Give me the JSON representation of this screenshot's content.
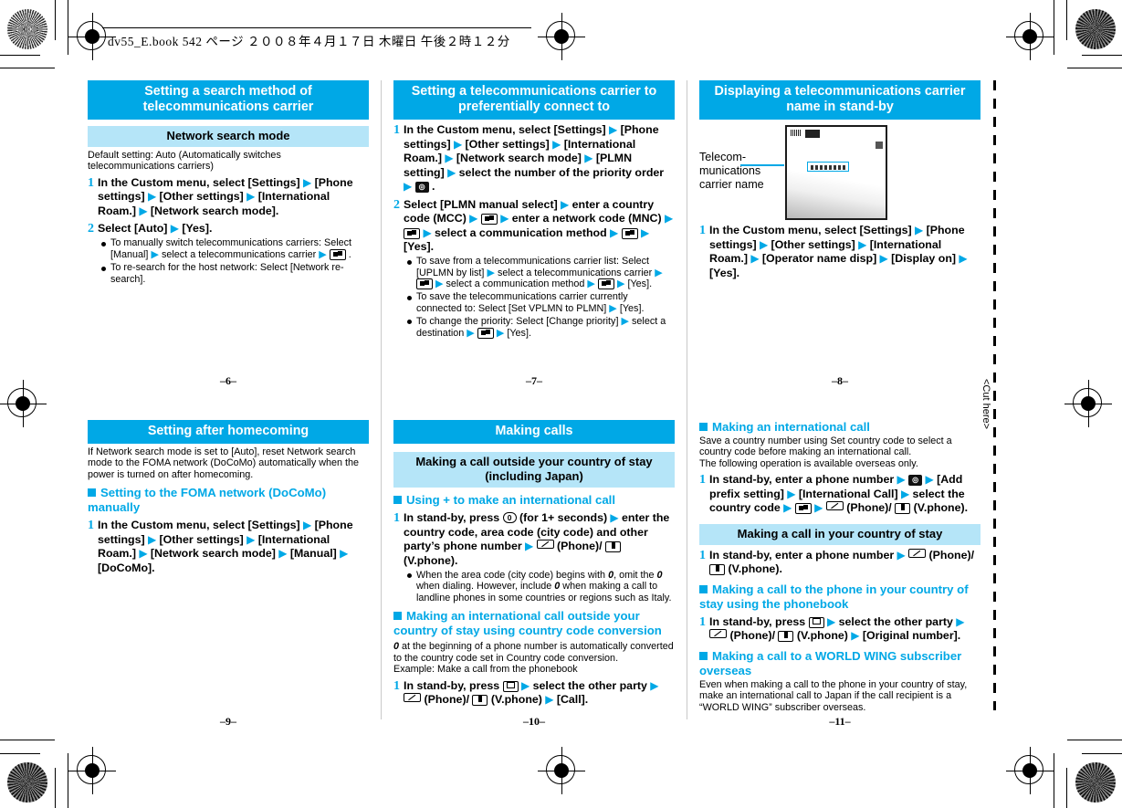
{
  "print": {
    "slug": "dv55_E.book  542 ページ  ２００８年４月１７日  木曜日  午後２時１２分",
    "cut_here": "<Cut here>"
  },
  "pages": [
    {
      "folio": "–6–",
      "title": "Setting a search method of telecommunications carrier",
      "subtitle": "Network search mode",
      "intro": "Default setting: Auto (Automatically switches telecommunications carriers)",
      "steps": [
        {
          "num": "1",
          "parts": [
            {
              "t": "In the Custom menu, select [Settings]"
            },
            {
              "a": "▶"
            },
            {
              "t": "[Phone settings]"
            },
            {
              "a": "▶"
            },
            {
              "t": "[Other settings]"
            },
            {
              "a": "▶"
            },
            {
              "t": "[International Roam.]"
            },
            {
              "a": "▶"
            },
            {
              "t": "[Network search mode]."
            }
          ]
        },
        {
          "num": "2",
          "parts": [
            {
              "t": "Select [Auto]"
            },
            {
              "a": "▶"
            },
            {
              "t": "[Yes]."
            }
          ],
          "bullets": [
            [
              {
                "t": "To manually switch telecommunications carriers: Select [Manual]"
              },
              {
                "a": "▶"
              },
              {
                "t": "select a telecommunications carrier"
              },
              {
                "a": "▶"
              },
              {
                "k": "sel"
              },
              {
                "t": "."
              }
            ],
            [
              {
                "t": "To re-search for the host network: Select [Network re-search]."
              }
            ]
          ]
        }
      ]
    },
    {
      "folio": "–7–",
      "title": "Setting a telecommunications carrier to preferentially connect to",
      "steps": [
        {
          "num": "1",
          "parts": [
            {
              "t": "In the Custom menu, select [Settings]"
            },
            {
              "a": "▶"
            },
            {
              "t": "[Phone settings]"
            },
            {
              "a": "▶"
            },
            {
              "t": "[Other settings]"
            },
            {
              "a": "▶"
            },
            {
              "t": "[International Roam.]"
            },
            {
              "a": "▶"
            },
            {
              "t": "[Network search mode]"
            },
            {
              "a": "▶"
            },
            {
              "t": "[PLMN setting]"
            },
            {
              "a": "▶"
            },
            {
              "t": "select the number of the priority order"
            },
            {
              "a": "▶"
            },
            {
              "k": "cam"
            },
            {
              "t": "."
            }
          ]
        },
        {
          "num": "2",
          "parts": [
            {
              "t": "Select [PLMN manual select]"
            },
            {
              "a": "▶"
            },
            {
              "t": "enter a country code (MCC)"
            },
            {
              "a": "▶"
            },
            {
              "k": "sel"
            },
            {
              "a": "▶"
            },
            {
              "t": "enter a network code (MNC)"
            },
            {
              "a": "▶"
            },
            {
              "k": "sel"
            },
            {
              "a": "▶"
            },
            {
              "t": "select a communication method"
            },
            {
              "a": "▶"
            },
            {
              "k": "sel"
            },
            {
              "a": "▶"
            },
            {
              "t": "[Yes]."
            }
          ],
          "bullets": [
            [
              {
                "t": "To save from a telecommunications carrier list: Select [UPLMN by list]"
              },
              {
                "a": "▶"
              },
              {
                "t": "select a telecommunications carrier"
              },
              {
                "a": "▶"
              },
              {
                "k": "sel"
              },
              {
                "a": "▶"
              },
              {
                "t": "select a communication method"
              },
              {
                "a": "▶"
              },
              {
                "k": "sel"
              },
              {
                "a": "▶"
              },
              {
                "t": "[Yes]."
              }
            ],
            [
              {
                "t": "To save the telecommunications carrier currently connected to: Select [Set VPLMN to PLMN]"
              },
              {
                "a": "▶"
              },
              {
                "t": "[Yes]."
              }
            ],
            [
              {
                "t": "To change the priority: Select [Change priority]"
              },
              {
                "a": "▶"
              },
              {
                "t": "select a destination"
              },
              {
                "a": "▶"
              },
              {
                "k": "sel"
              },
              {
                "a": "▶"
              },
              {
                "t": "[Yes]."
              }
            ]
          ]
        }
      ]
    },
    {
      "folio": "–8–",
      "title": "Displaying a telecommunications carrier name in stand-by",
      "illustration_label": "Telecom-\nmunications\ncarrier name",
      "steps": [
        {
          "num": "1",
          "parts": [
            {
              "t": "In the Custom menu, select [Settings]"
            },
            {
              "a": "▶"
            },
            {
              "t": "[Phone settings]"
            },
            {
              "a": "▶"
            },
            {
              "t": "[Other settings]"
            },
            {
              "a": "▶"
            },
            {
              "t": "[International Roam.]"
            },
            {
              "a": "▶"
            },
            {
              "t": "[Operator name disp]"
            },
            {
              "a": "▶"
            },
            {
              "t": "[Display on]"
            },
            {
              "a": "▶"
            },
            {
              "t": "[Yes]."
            }
          ]
        }
      ]
    },
    {
      "folio": "–9–",
      "title": "Setting after homecoming",
      "intro": "If Network search mode is set to [Auto], reset Network search mode to the FOMA network (DoCoMo) automatically when the power is turned on after homecoming.",
      "h3": "Setting to the FOMA network (DoCoMo) manually",
      "steps": [
        {
          "num": "1",
          "parts": [
            {
              "t": "In the Custom menu, select [Settings]"
            },
            {
              "a": "▶"
            },
            {
              "t": "[Phone settings]"
            },
            {
              "a": "▶"
            },
            {
              "t": "[Other settings]"
            },
            {
              "a": "▶"
            },
            {
              "t": "[International Roam.]"
            },
            {
              "a": "▶"
            },
            {
              "t": "[Network search mode]"
            },
            {
              "a": "▶"
            },
            {
              "t": "[Manual]"
            },
            {
              "a": "▶"
            },
            {
              "t": "[DoCoMo]."
            }
          ]
        }
      ]
    },
    {
      "folio": "–10–",
      "title": "Making calls",
      "subtitle": "Making a call outside your country of stay (including Japan)",
      "h3": "Using + to make an international call",
      "steps": [
        {
          "num": "1",
          "parts": [
            {
              "t": "In stand-by, press"
            },
            {
              "k": "num0"
            },
            {
              "t": "(for 1+ seconds)"
            },
            {
              "a": "▶"
            },
            {
              "t": "enter the country code, area code (city code) and other party’s phone number"
            },
            {
              "a": "▶"
            },
            {
              "k": "call"
            },
            {
              "t": "(Phone)/"
            },
            {
              "k": "vph"
            },
            {
              "t": "(V.phone)."
            }
          ],
          "bullets": [
            [
              {
                "t": "When the area code (city code) begins with "
              },
              {
                "i": "0"
              },
              {
                "t": ", omit the "
              },
              {
                "i": "0"
              },
              {
                "t": " when dialing. However, include "
              },
              {
                "i": "0"
              },
              {
                "t": " when making a call to landline phones in some countries or regions such as Italy."
              }
            ]
          ]
        }
      ],
      "h3b": "Making an international call outside your country of stay using country code conversion",
      "note_lead": "0",
      "note": " at the beginning of a phone number is automatically converted to the country code set in Country code conversion.",
      "example": "Example: Make a call from the phonebook",
      "steps2": [
        {
          "num": "1",
          "parts": [
            {
              "t": "In stand-by, press"
            },
            {
              "k": "mail"
            },
            {
              "a": "▶"
            },
            {
              "t": "select the other party"
            },
            {
              "a": "▶"
            },
            {
              "k": "call"
            },
            {
              "t": "(Phone)/"
            },
            {
              "k": "vph"
            },
            {
              "t": "(V.phone)"
            },
            {
              "a": "▶"
            },
            {
              "t": "[Call]."
            }
          ]
        }
      ]
    },
    {
      "folio": "–11–",
      "h3": "Making an international call",
      "intro": "Save a country number using Set country code to select a country code before making an international call.",
      "intro2": "The following operation is available overseas only.",
      "steps": [
        {
          "num": "1",
          "parts": [
            {
              "t": "In stand-by, enter a phone number"
            },
            {
              "a": "▶"
            },
            {
              "k": "cam"
            },
            {
              "a": "▶"
            },
            {
              "t": "[Add prefix setting]"
            },
            {
              "a": "▶"
            },
            {
              "t": "[International Call]"
            },
            {
              "a": "▶"
            },
            {
              "t": "select the country code"
            },
            {
              "a": "▶"
            },
            {
              "k": "sel"
            },
            {
              "a": "▶"
            },
            {
              "k": "call"
            },
            {
              "t": "(Phone)/"
            },
            {
              "k": "vph"
            },
            {
              "t": "(V.phone)."
            }
          ]
        }
      ],
      "subtitle": "Making a call in your country of stay",
      "steps2": [
        {
          "num": "1",
          "parts": [
            {
              "t": "In stand-by, enter a phone number"
            },
            {
              "a": "▶"
            },
            {
              "k": "call"
            },
            {
              "t": "(Phone)/"
            },
            {
              "k": "vph"
            },
            {
              "t": "(V.phone)."
            }
          ]
        }
      ],
      "h3b": "Making a call to the phone in your country of stay using the phonebook",
      "steps3": [
        {
          "num": "1",
          "parts": [
            {
              "t": "In stand-by, press"
            },
            {
              "k": "mail"
            },
            {
              "a": "▶"
            },
            {
              "t": "select the other party"
            },
            {
              "a": "▶"
            },
            {
              "k": "call"
            },
            {
              "t": "(Phone)/"
            },
            {
              "k": "vph"
            },
            {
              "t": "(V.phone)"
            },
            {
              "a": "▶"
            },
            {
              "t": "[Original number]."
            }
          ]
        }
      ],
      "h3c": "Making a call to a WORLD WING subscriber overseas",
      "outro": "Even when making a call to the phone in your country of stay, make an international call to Japan if the call recipient is a “WORLD WING” subscriber overseas."
    }
  ],
  "colors": {
    "primary": "#00a8e6",
    "secondary": "#b5e5f8"
  }
}
